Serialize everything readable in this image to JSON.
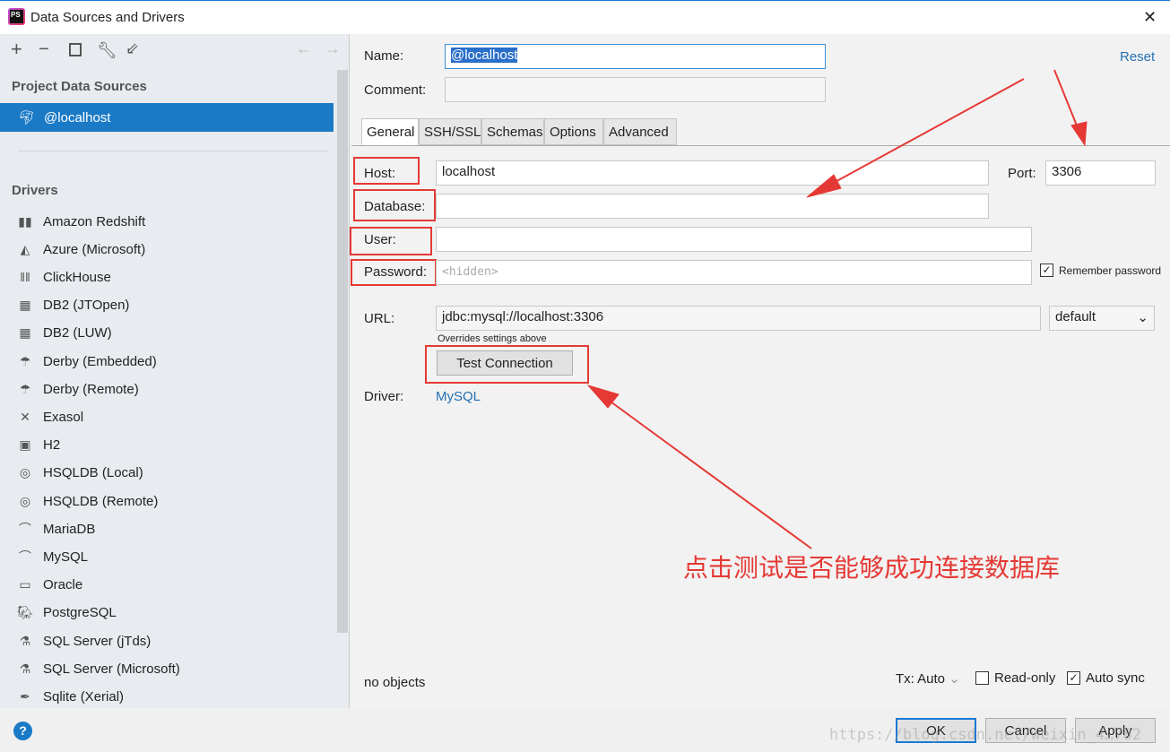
{
  "window": {
    "title": "Data Sources and Drivers",
    "app_icon": "PS",
    "close": "✕"
  },
  "toolbar": {
    "add": "+",
    "remove": "−",
    "copy": "copy-icon",
    "settings": "wrench-icon",
    "import": "import-icon",
    "back": "←",
    "forward": "→"
  },
  "left": {
    "project_header": "Project Data Sources",
    "selected_source": "@localhost",
    "drivers_header": "Drivers",
    "drivers": [
      "Amazon Redshift",
      "Azure (Microsoft)",
      "ClickHouse",
      "DB2 (JTOpen)",
      "DB2 (LUW)",
      "Derby (Embedded)",
      "Derby (Remote)",
      "Exasol",
      "H2",
      "HSQLDB (Local)",
      "HSQLDB (Remote)",
      "MariaDB",
      "MySQL",
      "Oracle",
      "PostgreSQL",
      "SQL Server (jTds)",
      "SQL Server (Microsoft)",
      "Sqlite (Xerial)"
    ]
  },
  "form": {
    "name_label": "Name:",
    "name_value": "@localhost",
    "comment_label": "Comment:",
    "comment_value": "",
    "reset": "Reset",
    "tabs": [
      "General",
      "SSH/SSL",
      "Schemas",
      "Options",
      "Advanced"
    ],
    "active_tab": "General",
    "host_label": "Host:",
    "host_value": "localhost",
    "port_label": "Port:",
    "port_value": "3306",
    "database_label": "Database:",
    "database_value": "",
    "user_label": "User:",
    "user_value": "",
    "password_label": "Password:",
    "password_placeholder": "<hidden>",
    "remember_password": "Remember password",
    "remember_checked": true,
    "url_label": "URL:",
    "url_value": "jdbc:mysql://localhost:3306",
    "url_mode": "default",
    "url_hint": "Overrides settings above",
    "test_connection": "Test Connection",
    "driver_label": "Driver:",
    "driver_value": "MySQL",
    "status": "no objects",
    "tx": "Tx: Auto",
    "read_only": "Read-only",
    "read_only_checked": false,
    "auto_sync": "Auto sync",
    "auto_sync_checked": true
  },
  "buttons": {
    "ok": "OK",
    "cancel": "Cancel",
    "apply": "Apply",
    "help": "?"
  },
  "annotation": {
    "text": "点击测试是否能够成功连接数据库",
    "color": "#e53935"
  },
  "watermark": "https://blog.csdn.net/weixin_4…782"
}
